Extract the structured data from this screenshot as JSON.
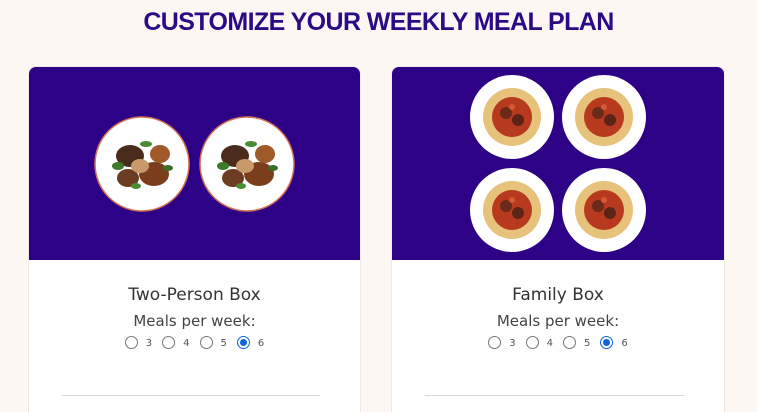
{
  "page": {
    "title": "CUSTOMIZE YOUR WEEKLY MEAL PLAN"
  },
  "colors": {
    "title": "#2b0a86",
    "image_bg": "#2d0287",
    "radio_selected": "#0b66d6",
    "background": "#fdf7f4"
  },
  "plans": [
    {
      "title": "Two-Person Box",
      "meals_label": "Meals per week:",
      "image": "two-chicken-plates",
      "options": [
        "3",
        "4",
        "5",
        "6"
      ],
      "selected": "6"
    },
    {
      "title": "Family Box",
      "meals_label": "Meals per week:",
      "image": "four-pasta-plates",
      "options": [
        "3",
        "4",
        "5",
        "6"
      ],
      "selected": "6"
    }
  ]
}
